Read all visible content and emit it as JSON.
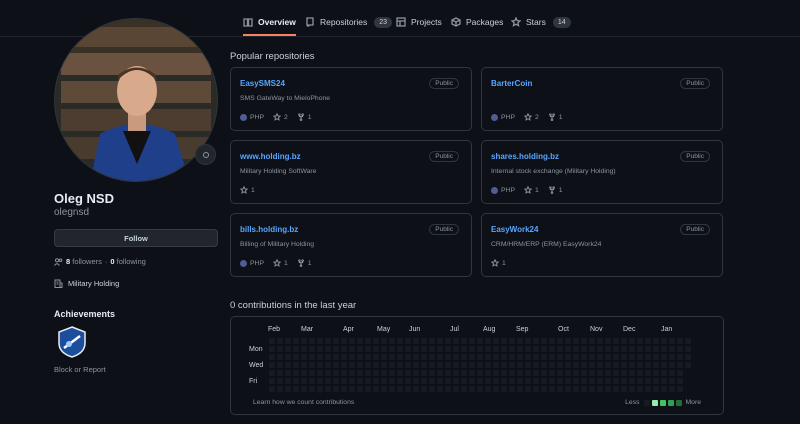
{
  "tabs": [
    {
      "label": "Overview",
      "icon": "book-icon"
    },
    {
      "label": "Repositories",
      "count": "23",
      "icon": "repo-icon"
    },
    {
      "label": "Projects",
      "icon": "table-icon"
    },
    {
      "label": "Packages",
      "icon": "package-icon"
    },
    {
      "label": "Stars",
      "count": "14",
      "icon": "star-icon"
    }
  ],
  "profile": {
    "fullname": "Oleg NSD",
    "username": "olegnsd",
    "follow_label": "Follow",
    "followers_count": "8",
    "followers_label": "followers",
    "following_count": "0",
    "following_label": "following",
    "organization": "Military Holding",
    "achievements_title": "Achievements",
    "block_label": "Block or Report"
  },
  "popular": {
    "title": "Popular repositories",
    "repos": [
      {
        "name": "EasySMS24",
        "visibility": "Public",
        "description": "SMS GateWay to MieloPhone",
        "language": "PHP",
        "stars": "2",
        "forks": "1"
      },
      {
        "name": "BarterCoin",
        "visibility": "Public",
        "description": "",
        "language": "PHP",
        "stars": "2",
        "forks": "1"
      },
      {
        "name": "www.holding.bz",
        "visibility": "Public",
        "description": "Military Holding SoftWare",
        "language": "",
        "stars": "1",
        "forks": ""
      },
      {
        "name": "shares.holding.bz",
        "visibility": "Public",
        "description": "Internal stock exchange (Military Holding)",
        "language": "PHP",
        "stars": "1",
        "forks": "1"
      },
      {
        "name": "bills.holding.bz",
        "visibility": "Public",
        "description": "Billing of Military Holding",
        "language": "PHP",
        "stars": "1",
        "forks": "1"
      },
      {
        "name": "EasyWork24",
        "visibility": "Public",
        "description": "CRM/HRM/ERP (ERM) EasyWork24",
        "language": "",
        "stars": "1",
        "forks": ""
      }
    ]
  },
  "contributions": {
    "title": "0 contributions in the last year",
    "months": [
      "Feb",
      "Mar",
      "Apr",
      "May",
      "Jun",
      "Jul",
      "Aug",
      "Sep",
      "Oct",
      "Nov",
      "Dec",
      "Jan"
    ],
    "days": [
      "Mon",
      "Wed",
      "Fri"
    ],
    "learn_label": "Learn how we count contributions",
    "less_label": "Less",
    "more_label": "More",
    "legend_colors": [
      "#161b22",
      "#9be9a8",
      "#40c463",
      "#30a14e",
      "#216e39"
    ]
  },
  "colors": {
    "accent_tab": "#f78166",
    "link": "#58a6ff",
    "php": "#4f5d95"
  }
}
